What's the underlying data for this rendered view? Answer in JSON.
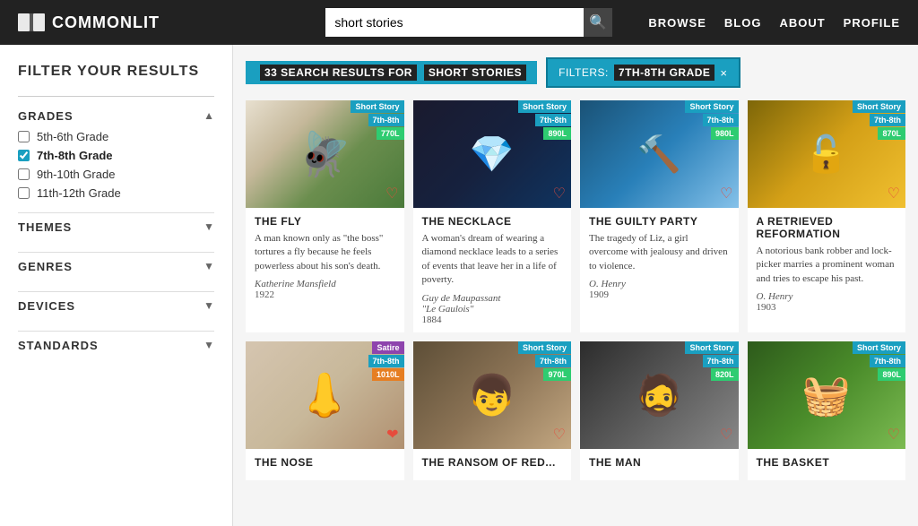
{
  "header": {
    "logo_text": "COMMONLIT",
    "search_value": "short stories",
    "search_placeholder": "short stories",
    "nav": [
      "BROWSE",
      "BLOG",
      "ABOUT",
      "PROFILE"
    ]
  },
  "sidebar": {
    "filter_title": "FILTER YOUR RESULTS",
    "grades": {
      "title": "GRADES",
      "items": [
        {
          "label": "5th-6th Grade",
          "checked": false
        },
        {
          "label": "7th-8th Grade",
          "checked": true
        },
        {
          "label": "9th-10th Grade",
          "checked": false
        },
        {
          "label": "11th-12th Grade",
          "checked": false
        }
      ]
    },
    "themes": {
      "title": "THEMES"
    },
    "genres": {
      "title": "GENRES"
    },
    "devices": {
      "title": "DEVICES"
    },
    "standards": {
      "title": "STANDARDS"
    }
  },
  "results": {
    "count_label": "33 SEARCH RESULTS FOR",
    "count_highlight": "SHORT STORIES",
    "filter_label": "FILTERS:",
    "filter_value": "7TH-8TH GRADE",
    "filter_x": "×"
  },
  "cards": [
    {
      "id": "fly",
      "title": "THE FLY",
      "type_badge": "Short Story",
      "grade_badge": "7th-8th",
      "lexile_badge": "770L",
      "lexile_color": "green",
      "description": "A man known only as \"the boss\" tortures a fly because he feels powerless about his son's death.",
      "author": "Katherine Mansfield",
      "year": "1922",
      "img_class": "img-fly"
    },
    {
      "id": "necklace",
      "title": "THE NECKLACE",
      "type_badge": "Short Story",
      "grade_badge": "7th-8th",
      "lexile_badge": "890L",
      "lexile_color": "green",
      "description": "A woman's dream of wearing a diamond necklace leads to a series of events that leave her in a life of poverty.",
      "author": "Guy de Maupassant",
      "author2": "\"Le Gaulois\"",
      "year": "1884",
      "img_class": "img-necklace"
    },
    {
      "id": "guilty",
      "title": "THE GUILTY PARTY",
      "type_badge": "Short Story",
      "grade_badge": "7th-8th",
      "lexile_badge": "980L",
      "lexile_color": "green",
      "description": "The tragedy of Liz, a girl overcome with jealousy and driven to violence.",
      "author": "O. Henry",
      "year": "1909",
      "img_class": "img-guilty"
    },
    {
      "id": "retrieved",
      "title": "A RETRIEVED REFORMATION",
      "type_badge": "Short Story",
      "grade_badge": "7th-8th",
      "lexile_badge": "870L",
      "lexile_color": "green",
      "description": "A notorious bank robber and lock-picker marries a prominent woman and tries to escape his past.",
      "author": "O. Henry",
      "year": "1903",
      "img_class": "img-retrieved"
    },
    {
      "id": "nose",
      "title": "THE NOSE",
      "type_badge": "Satire",
      "grade_badge": "7th-8th",
      "lexile_badge": "1010L",
      "lexile_color": "orange",
      "description": "",
      "author": "",
      "year": "",
      "img_class": "img-nose"
    },
    {
      "id": "ransom",
      "title": "THE RANSOM OF RED...",
      "type_badge": "Short Story",
      "grade_badge": "7th-8th",
      "lexile_badge": "970L",
      "lexile_color": "green",
      "description": "",
      "author": "",
      "year": "",
      "img_class": "img-ransom"
    },
    {
      "id": "man",
      "title": "THE MAN",
      "type_badge": "Short Story",
      "grade_badge": "7th-8th",
      "lexile_badge": "820L",
      "lexile_color": "green",
      "description": "",
      "author": "",
      "year": "",
      "img_class": "img-man"
    },
    {
      "id": "basket",
      "title": "THE BASKET",
      "type_badge": "Short Story",
      "grade_badge": "7th-8th",
      "lexile_badge": "890L",
      "lexile_color": "green",
      "description": "",
      "author": "",
      "year": "",
      "img_class": "img-basket"
    }
  ]
}
